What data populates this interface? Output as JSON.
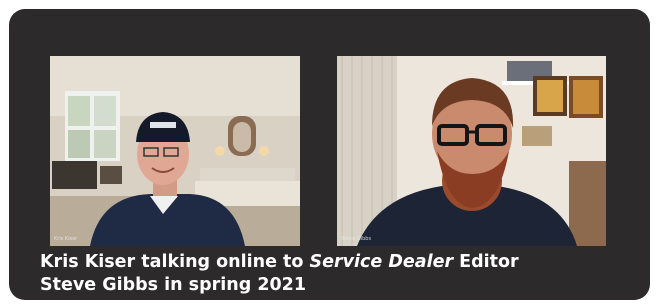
{
  "caption": {
    "line1_before": "Kris Kiser talking online to ",
    "line1_italic": "Service Dealer",
    "line1_after": " Editor",
    "line2": "Steve Gibbs in spring 2021"
  },
  "participants": [
    {
      "name_tag": "Kris Kiser"
    },
    {
      "name_tag": "Steve Gibbs"
    }
  ],
  "colors": {
    "frame": "#2c2a2b",
    "caption_text": "#ffffff"
  }
}
